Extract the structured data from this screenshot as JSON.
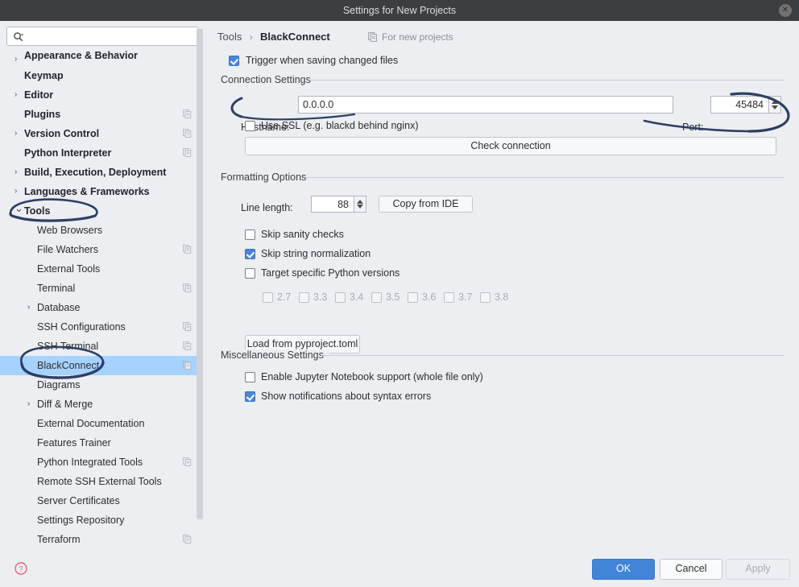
{
  "window": {
    "title": "Settings for New Projects",
    "close_icon": "close-icon"
  },
  "sidebar": {
    "search": {
      "value": "",
      "placeholder": "",
      "icon": "search-icon"
    },
    "items": [
      {
        "label": "Appearance & Behavior",
        "level": 0,
        "bold": true,
        "arrow": "chevron-right",
        "badge": false,
        "selected": false,
        "clipped": true
      },
      {
        "label": "Keymap",
        "level": 0,
        "bold": true,
        "arrow": "",
        "badge": false,
        "selected": false
      },
      {
        "label": "Editor",
        "level": 0,
        "bold": true,
        "arrow": "chevron-right",
        "badge": false,
        "selected": false
      },
      {
        "label": "Plugins",
        "level": 0,
        "bold": true,
        "arrow": "",
        "badge": true,
        "selected": false
      },
      {
        "label": "Version Control",
        "level": 0,
        "bold": true,
        "arrow": "chevron-right",
        "badge": true,
        "selected": false
      },
      {
        "label": "Python Interpreter",
        "level": 0,
        "bold": true,
        "arrow": "",
        "badge": true,
        "selected": false
      },
      {
        "label": "Build, Execution, Deployment",
        "level": 0,
        "bold": true,
        "arrow": "chevron-right",
        "badge": false,
        "selected": false
      },
      {
        "label": "Languages & Frameworks",
        "level": 0,
        "bold": true,
        "arrow": "chevron-right",
        "badge": false,
        "selected": false
      },
      {
        "label": "Tools",
        "level": 0,
        "bold": true,
        "arrow": "chevron-down",
        "badge": false,
        "selected": false
      },
      {
        "label": "Web Browsers",
        "level": 1,
        "bold": false,
        "arrow": "",
        "badge": false,
        "selected": false
      },
      {
        "label": "File Watchers",
        "level": 1,
        "bold": false,
        "arrow": "",
        "badge": true,
        "selected": false
      },
      {
        "label": "External Tools",
        "level": 1,
        "bold": false,
        "arrow": "",
        "badge": false,
        "selected": false
      },
      {
        "label": "Terminal",
        "level": 1,
        "bold": false,
        "arrow": "",
        "badge": true,
        "selected": false
      },
      {
        "label": "Database",
        "level": 1,
        "bold": false,
        "arrow": "chevron-right",
        "badge": false,
        "selected": false
      },
      {
        "label": "SSH Configurations",
        "level": 1,
        "bold": false,
        "arrow": "",
        "badge": true,
        "selected": false
      },
      {
        "label": "SSH Terminal",
        "level": 1,
        "bold": false,
        "arrow": "",
        "badge": true,
        "selected": false
      },
      {
        "label": "BlackConnect",
        "level": 1,
        "bold": false,
        "arrow": "",
        "badge": true,
        "selected": true
      },
      {
        "label": "Diagrams",
        "level": 1,
        "bold": false,
        "arrow": "",
        "badge": false,
        "selected": false
      },
      {
        "label": "Diff & Merge",
        "level": 1,
        "bold": false,
        "arrow": "chevron-right",
        "badge": false,
        "selected": false
      },
      {
        "label": "External Documentation",
        "level": 1,
        "bold": false,
        "arrow": "",
        "badge": false,
        "selected": false
      },
      {
        "label": "Features Trainer",
        "level": 1,
        "bold": false,
        "arrow": "",
        "badge": false,
        "selected": false
      },
      {
        "label": "Python Integrated Tools",
        "level": 1,
        "bold": false,
        "arrow": "",
        "badge": true,
        "selected": false
      },
      {
        "label": "Remote SSH External Tools",
        "level": 1,
        "bold": false,
        "arrow": "",
        "badge": false,
        "selected": false
      },
      {
        "label": "Server Certificates",
        "level": 1,
        "bold": false,
        "arrow": "",
        "badge": false,
        "selected": false
      },
      {
        "label": "Settings Repository",
        "level": 1,
        "bold": false,
        "arrow": "",
        "badge": false,
        "selected": false
      },
      {
        "label": "Terraform",
        "level": 1,
        "bold": false,
        "arrow": "",
        "badge": true,
        "selected": false
      }
    ]
  },
  "header": {
    "breadcrumb_root": "Tools",
    "breadcrumb_separator": "›",
    "breadcrumb_current": "BlackConnect",
    "scope_badge": "For new projects",
    "scope_icon": "copy-icon"
  },
  "main": {
    "trigger_on_save": {
      "label": "Trigger when saving changed files",
      "checked": true
    },
    "connection": {
      "group_title": "Connection Settings",
      "hostname_label": "Hostname:",
      "hostname_value": "0.0.0.0",
      "port_label": "Port:",
      "port_value": "45484",
      "use_ssl": {
        "label": "Use SSL (e.g. blackd behind nginx)",
        "checked": false
      },
      "check_connection_label": "Check connection"
    },
    "formatting": {
      "group_title": "Formatting Options",
      "line_length_label": "Line length:",
      "line_length_value": "88",
      "copy_from_ide_label": "Copy from IDE",
      "skip_sanity_checks": {
        "label": "Skip sanity checks",
        "checked": false
      },
      "skip_string_normalization": {
        "label": "Skip string normalization",
        "checked": true
      },
      "target_specific_versions": {
        "label": "Target specific Python versions",
        "checked": false
      },
      "versions": [
        {
          "label": "2.7",
          "checked": false,
          "disabled": true
        },
        {
          "label": "3.3",
          "checked": false,
          "disabled": true
        },
        {
          "label": "3.4",
          "checked": false,
          "disabled": true
        },
        {
          "label": "3.5",
          "checked": false,
          "disabled": true
        },
        {
          "label": "3.6",
          "checked": false,
          "disabled": true
        },
        {
          "label": "3.7",
          "checked": false,
          "disabled": true
        },
        {
          "label": "3.8",
          "checked": false,
          "disabled": true
        }
      ],
      "load_pyproject_label": "Load from pyproject.toml"
    },
    "misc": {
      "group_title": "Miscellaneous Settings",
      "jupyter_support": {
        "label": "Enable Jupyter Notebook support (whole file only)",
        "checked": false
      },
      "syntax_notifications": {
        "label": "Show notifications about syntax errors",
        "checked": true
      }
    }
  },
  "footer": {
    "help_icon": "help-icon",
    "ok_label": "OK",
    "cancel_label": "Cancel",
    "apply_label": "Apply"
  },
  "colors": {
    "titlebar_bg": "#3c3f41",
    "panel_bg": "#eceef2",
    "selection_blue": "#a6d2ff",
    "accent_blue": "#4285d8",
    "checkbox_blue": "#4a86d8",
    "annotation_ink": "#2d3f63",
    "help_pink": "#e8607f"
  }
}
